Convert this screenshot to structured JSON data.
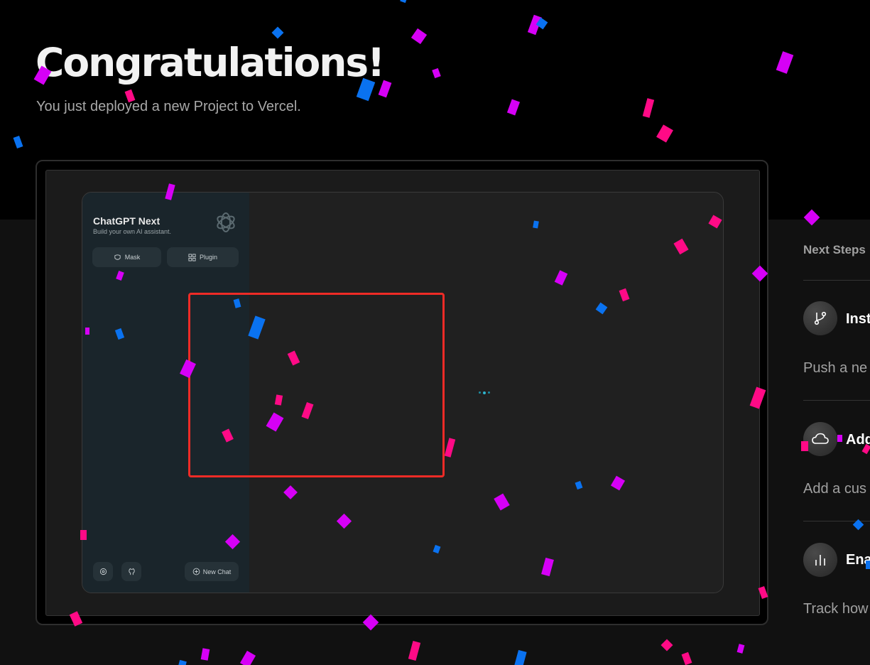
{
  "hero": {
    "title": "Congratulations!",
    "subtitle": "You just deployed a new Project to Vercel."
  },
  "preview": {
    "app_title": "ChatGPT Next",
    "app_subtitle": "Build your own AI assistant.",
    "mask_label": "Mask",
    "plugin_label": "Plugin",
    "new_chat_label": "New Chat"
  },
  "next_steps": {
    "title": "Next Steps",
    "items": [
      {
        "label": "Inst",
        "desc": "Push a ne",
        "icon": "git-branch-icon"
      },
      {
        "label": "Add",
        "desc": "Add a cus",
        "icon": "cloud-icon"
      },
      {
        "label": "Ena",
        "desc": "Track how",
        "icon": "bar-chart-icon"
      }
    ]
  },
  "colors": {
    "accent_pink": "#ff0a86",
    "accent_magenta": "#d600f6",
    "accent_blue": "#0a72f0",
    "highlight_red": "#ee2b26"
  }
}
